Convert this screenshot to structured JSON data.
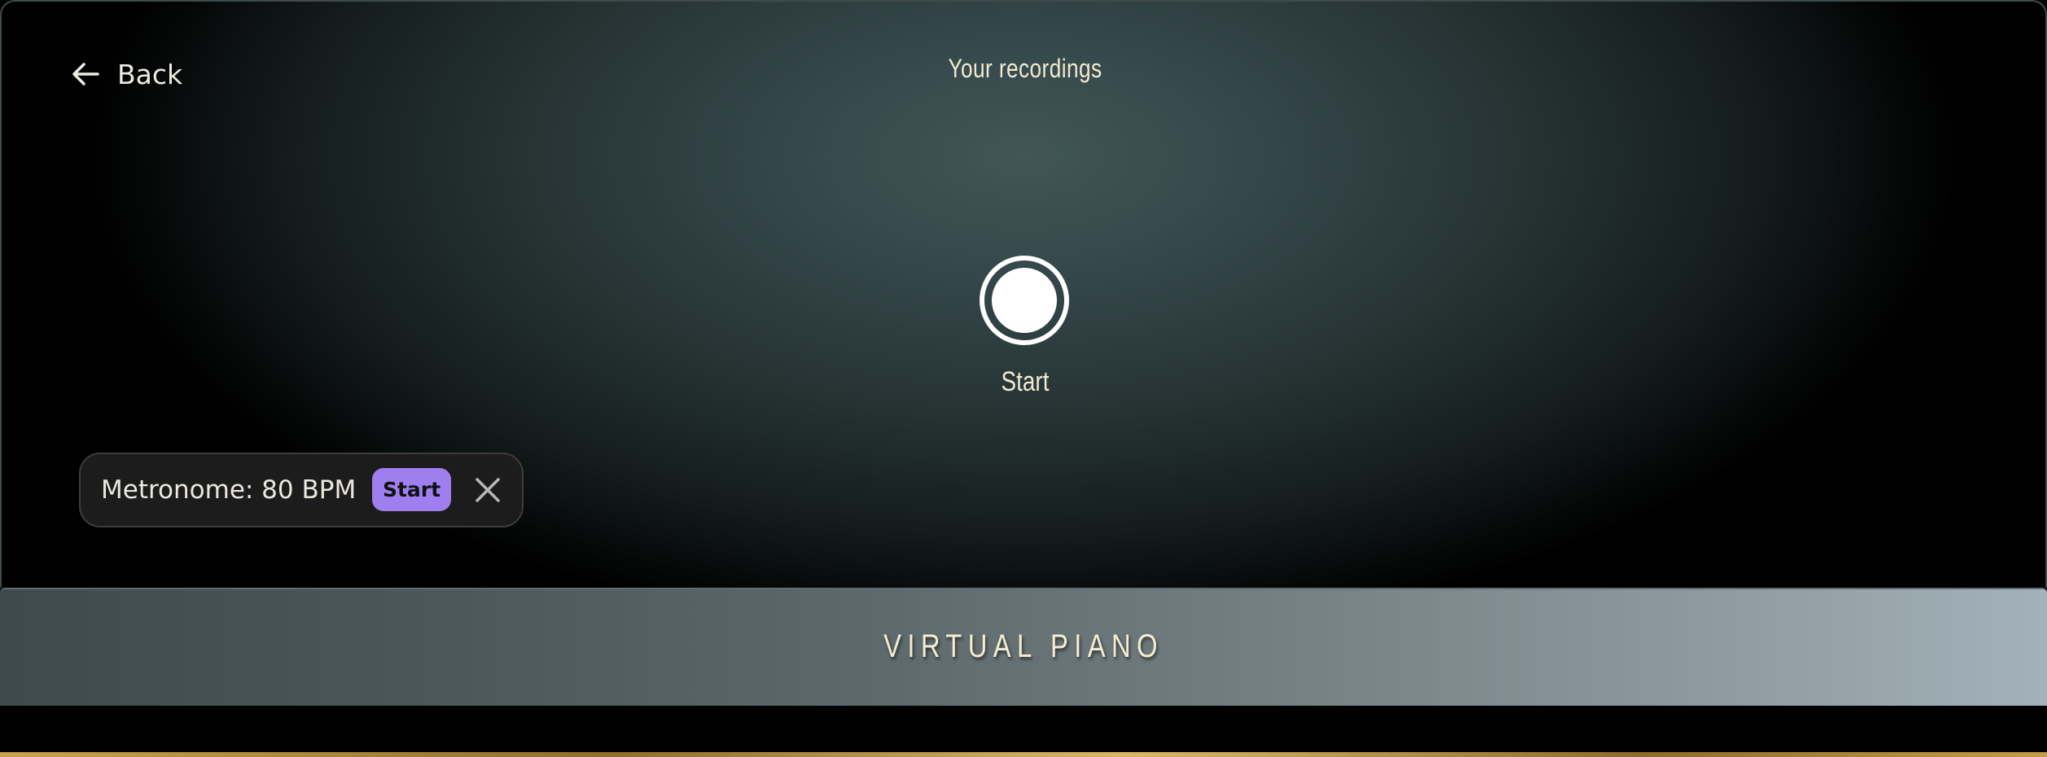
{
  "header": {
    "back_label": "Back",
    "title": "Your recordings",
    "back_icon": "arrow-left-icon"
  },
  "recorder": {
    "button_label": "Start",
    "button_icon": "record-circle-icon"
  },
  "metronome": {
    "label": "Metronome: 80 BPM",
    "start_label": "Start",
    "close_icon": "close-icon",
    "accent_color": "#9f7ff0"
  },
  "banner": {
    "title": "VIRTUAL PIANO"
  }
}
